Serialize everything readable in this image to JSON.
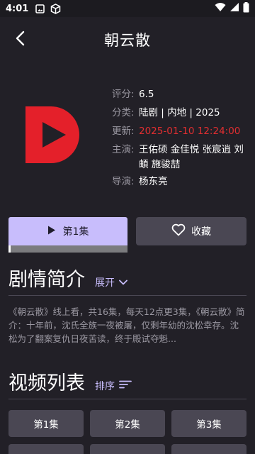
{
  "status_bar": {
    "time": "4:01",
    "icons": [
      "image-icon",
      "box-icon",
      "wifi-icon",
      "signal-icon",
      "battery-icon"
    ]
  },
  "header": {
    "title": "朝云散",
    "back_icon": "chevron-left-icon"
  },
  "poster": {
    "icon": "play-logo",
    "color": "#e4202a"
  },
  "info": {
    "rating_label": "评分:",
    "rating_value": "6.5",
    "category_label": "分类:",
    "category_value": "陆剧 | 内地 | 2025",
    "updated_label": "更新:",
    "updated_value": "2025-01-10 12:24:00",
    "cast_label": "主演:",
    "cast_value": "王佑硕 金佳悦 张宸逍 刘頔 施骏喆",
    "director_label": "导演:",
    "director_value": "杨东亮"
  },
  "actions": {
    "play_label": "第1集",
    "play_progress": 0.02,
    "collect_label": "收藏"
  },
  "synopsis_section": {
    "title": "剧情简介",
    "expand_label": "展开",
    "text": "《朝云散》线上看，共16集，每天12点更3集，《朝云散》简介：十年前，沈氏全族一夜被屠，仅剩年幼的沈松幸存。沈松为了翻案复仇日夜苦读，终于殿试夺魁..."
  },
  "episodes_section": {
    "title": "视频列表",
    "sort_label": "排序",
    "episodes": [
      "第1集",
      "第2集",
      "第3集"
    ]
  },
  "colors": {
    "background": "#222027",
    "accent": "#c8bdfc",
    "button_bg": "#4a4753",
    "update_red": "#e02e30"
  }
}
